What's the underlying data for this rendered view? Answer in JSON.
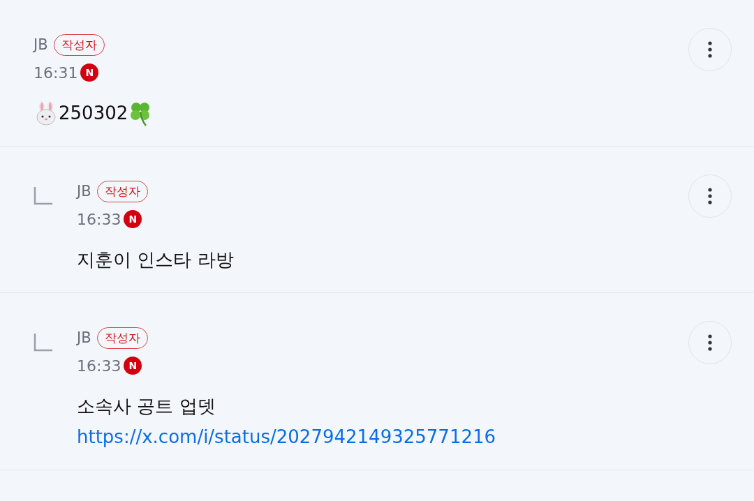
{
  "comments": [
    {
      "kind": "comment",
      "author": "JB",
      "author_badge": "작성자",
      "time": "16:31",
      "new": true,
      "new_label": "N",
      "body": [
        {
          "kind": "rabbit"
        },
        {
          "kind": "text",
          "text": "250302"
        },
        {
          "kind": "clover"
        }
      ]
    },
    {
      "kind": "reply",
      "author": "JB",
      "author_badge": "작성자",
      "time": "16:33",
      "new": true,
      "new_label": "N",
      "body": [
        {
          "kind": "text",
          "text": "지훈이 인스타 라방"
        }
      ]
    },
    {
      "kind": "reply",
      "author": "JB",
      "author_badge": "작성자",
      "time": "16:33",
      "new": true,
      "new_label": "N",
      "body": [
        {
          "kind": "text",
          "text": "소속사 공트 업뎃"
        },
        {
          "kind": "link",
          "text": "https://x.com/i/status/2027942149325771216"
        }
      ]
    }
  ]
}
